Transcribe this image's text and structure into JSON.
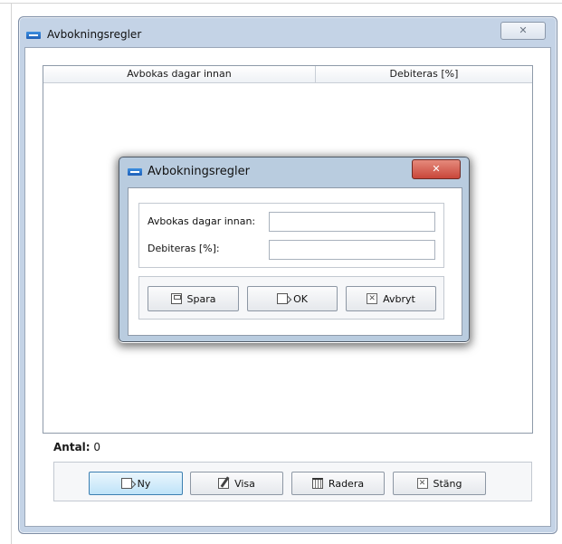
{
  "window": {
    "title": "Avbokningsregler",
    "close_glyph": "✕",
    "grid": {
      "columns": [
        "Avbokas dagar innan",
        "Debiteras [%]"
      ],
      "rows": []
    },
    "count_label": "Antal:",
    "count_value": "0",
    "buttons": {
      "new": "Ny",
      "view": "Visa",
      "delete": "Radera",
      "close": "Stäng"
    }
  },
  "dialog": {
    "title": "Avbokningsregler",
    "close_glyph": "✕",
    "fields": {
      "days_label": "Avbokas dagar innan:",
      "days_value": "",
      "charge_label": "Debiteras [%]:",
      "charge_value": ""
    },
    "buttons": {
      "save": "Spara",
      "ok": "OK",
      "cancel": "Avbryt"
    }
  },
  "icons": {
    "app": "app-logo-icon",
    "new": "new-document-icon",
    "view": "view-icon",
    "delete": "trash-icon",
    "close": "close-x-icon",
    "save": "save-icon",
    "ok": "ok-arrow-icon",
    "cancel": "cancel-x-icon"
  },
  "colors": {
    "window_frame": "#c4d3e6",
    "dialog_frame": "#b9ccdf",
    "dialog_close": "#c9463a",
    "primary_button": "#bfe3f8"
  }
}
